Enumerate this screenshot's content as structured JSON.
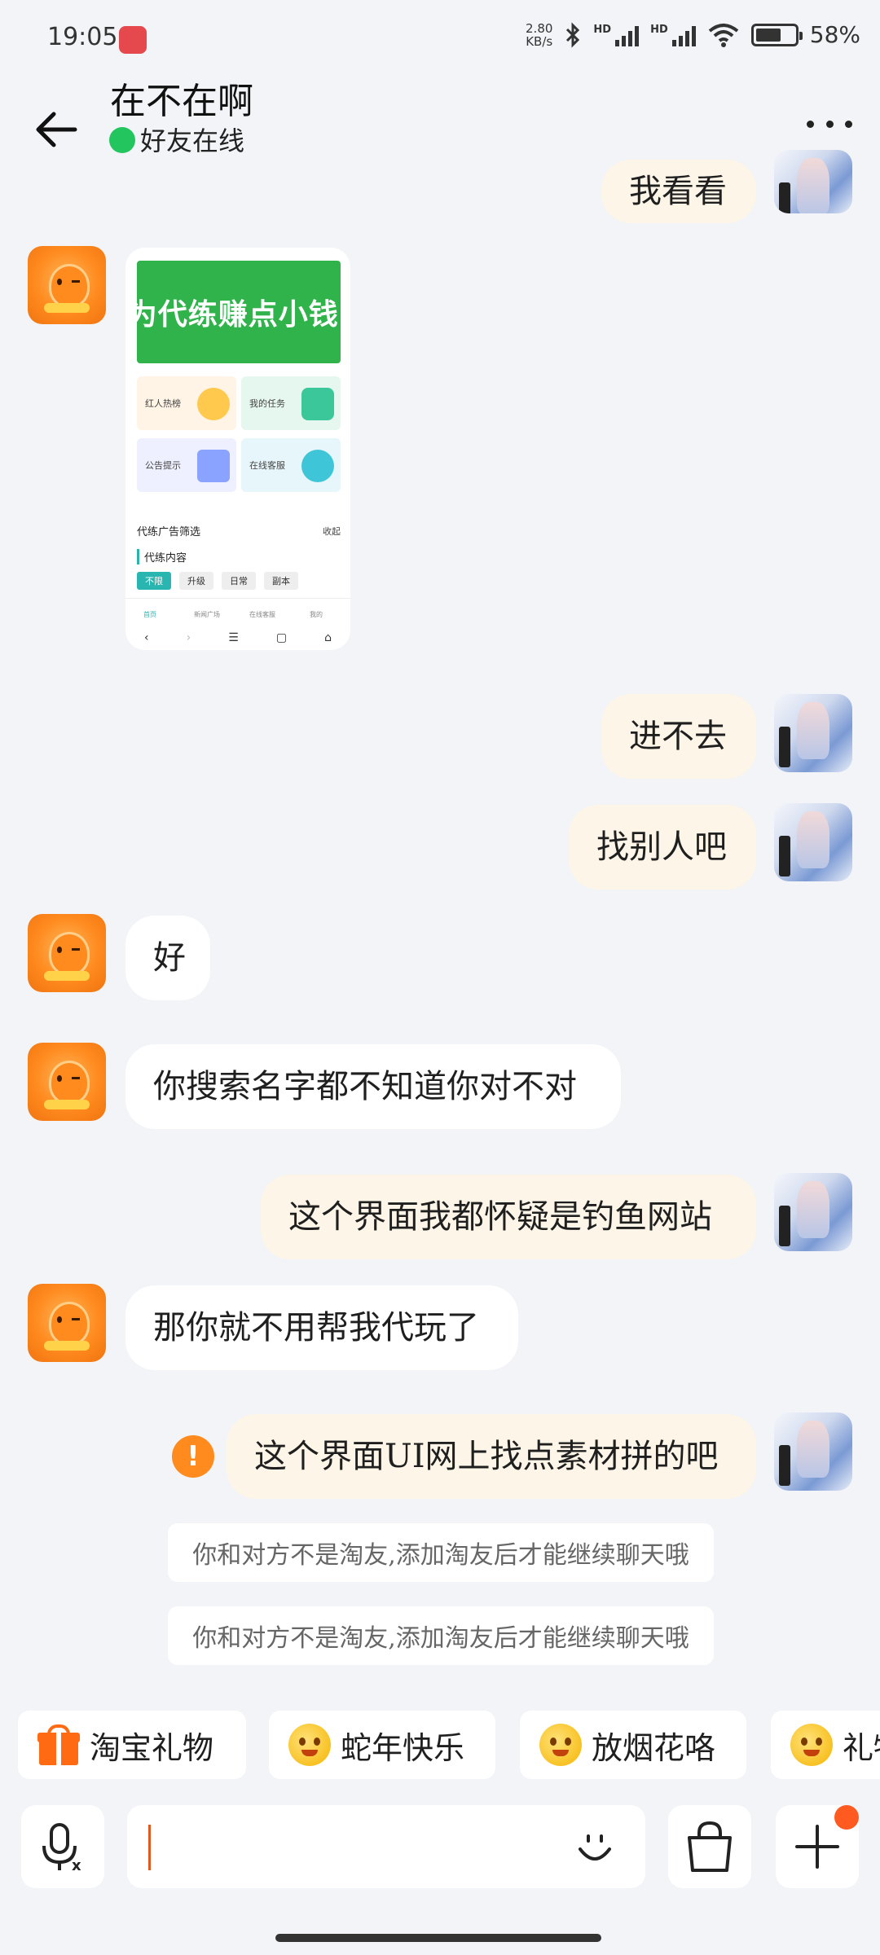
{
  "status_bar": {
    "time": "19:05",
    "net_speed_value": "2.80",
    "net_speed_unit": "KB/s",
    "hd1": "HD",
    "hd2": "HD",
    "battery": "58%"
  },
  "header": {
    "title": "在不在啊",
    "status": "好友在线"
  },
  "messages": {
    "m0": "我看看",
    "img": {
      "banner": "成为代练赚点小钱 ！",
      "tiles": [
        "红人热榜",
        "我的任务",
        "公告提示",
        "在线客服"
      ],
      "filter_title": "代练广告筛选",
      "collapse": "收起",
      "section": "代练内容",
      "chips": [
        "不限",
        "升级",
        "日常",
        "副本"
      ],
      "tabs": [
        "首页",
        "新闻广场",
        "在线客服",
        "我的"
      ]
    },
    "m1": "进不去",
    "m2": "找别人吧",
    "m3": "好",
    "m4": "你搜索名字都不知道你对不对",
    "m5": "这个界面我都怀疑是钓鱼网站",
    "m6": "那你就不用帮我代玩了",
    "m7": "这个界面UI网上找点素材拼的吧",
    "error_mark": "!",
    "system_notice_1": "你和对方不是淘友,添加淘友后才能继续聊天哦",
    "system_notice_2": "你和对方不是淘友,添加淘友后才能继续聊天哦"
  },
  "quick_replies": [
    "淘宝礼物",
    "蛇年快乐",
    "放烟花咯",
    "礼物"
  ],
  "input": {
    "value": ""
  },
  "colors": {
    "my_bubble": "#fdf5e8",
    "their_bubble": "#ffffff",
    "online": "#22c55e",
    "accent": "#ff6a13"
  },
  "icons": [
    "back-arrow-icon",
    "more-icon",
    "voice-icon",
    "emoji-icon",
    "shopping-bag-icon",
    "plus-icon",
    "error-icon"
  ]
}
